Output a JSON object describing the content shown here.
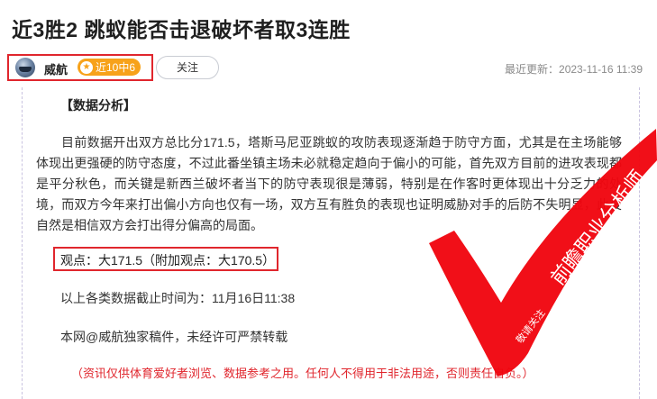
{
  "article": {
    "title": "近3胜2 跳蚁能否击退破坏者取3连胜",
    "author": {
      "name": "威航",
      "badge": "近10中6",
      "follow_label": "关注"
    },
    "updated": "最近更新：2023-11-16 11:39"
  },
  "body": {
    "section_heading": "【数据分析】",
    "paragraph": "目前数据开出双方总比分171.5，塔斯马尼亚跳蚁的攻防表现逐渐趋于防守方面，尤其是在主场能够体现出更强硬的防守态度，不过此番坐镇主场未必就稳定趋向于偏小的可能，首先双方目前的进攻表现都是平分秋色，而关键是新西兰破坏者当下的防守表现很是薄弱，特别是在作客时更体现出十分乏力的处境，而双方今年来打出偏小方向也仅有一场，双方互有胜负的表现也证明威胁对手的后防不失明显，此役自然是相信双方会打出得分偏高的局面。",
    "viewpoint": "观点：大171.5（附加观点：大170.5）",
    "data_cutoff": "以上各类数据截止时间为：11月16日11:38",
    "copyright": "本网@威航独家稿件，未经许可严禁转载",
    "disclaimer": "（资讯仅供体育爱好者浏览、数据参考之用。任何人不得用于非法用途，否则责任自负。）"
  },
  "watermark": {
    "text": "前瞻职业分析师",
    "small_text": "敬请关注",
    "color": "#f0050f"
  },
  "colors": {
    "highlight_box": "#e0262d",
    "badge": "#f7a21a"
  }
}
